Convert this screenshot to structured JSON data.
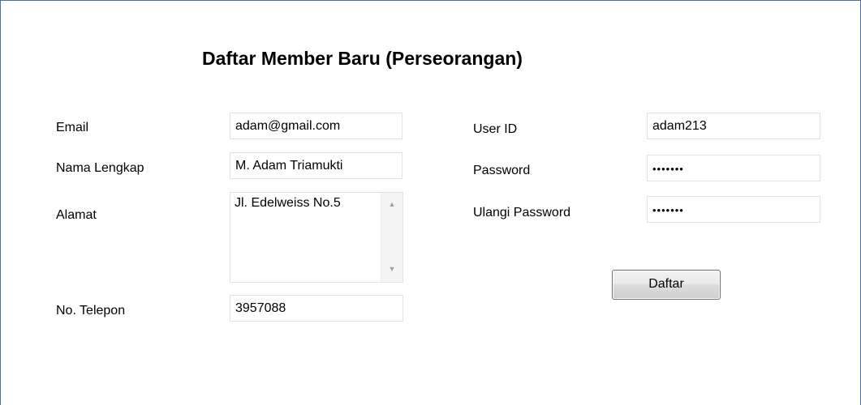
{
  "form": {
    "title": "Daftar Member Baru (Perseorangan)",
    "left": {
      "email_label": "Email",
      "email_value": "adam@gmail.com",
      "nama_label": "Nama Lengkap",
      "nama_value": "M. Adam Triamukti",
      "alamat_label": "Alamat",
      "alamat_value": "Jl. Edelweiss No.5",
      "telepon_label": "No. Telepon",
      "telepon_value": "3957088"
    },
    "right": {
      "userid_label": "User ID",
      "userid_value": "adam213",
      "password_label": "Password",
      "password_value": "•••••••",
      "ulangi_label": "Ulangi Password",
      "ulangi_value": "•••••••"
    },
    "submit_label": "Daftar"
  },
  "icons": {
    "scroll_up": "▲",
    "scroll_down": "▼"
  }
}
